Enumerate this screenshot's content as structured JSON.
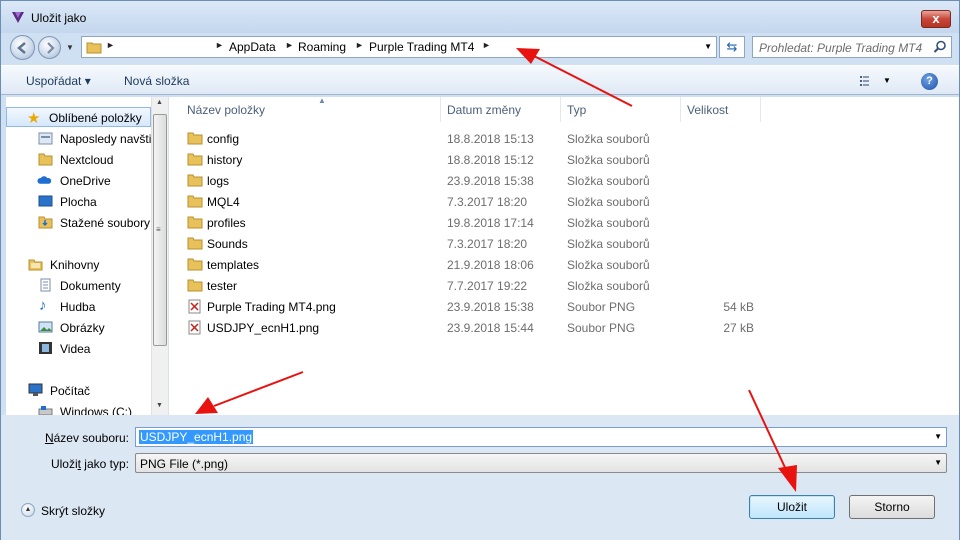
{
  "window": {
    "title": "Uložit jako",
    "close_label": "x"
  },
  "address": {
    "crumbs": [
      "AppData",
      "Roaming",
      "Purple Trading MT4"
    ],
    "search_placeholder": "Prohledat: Purple Trading MT4"
  },
  "toolbar": {
    "organize_label": "Uspořádat ▾",
    "new_folder_label": "Nová složka",
    "help_label": "?"
  },
  "navigation": {
    "favorites_header": "Oblíbené položky",
    "favorites": [
      "Naposledy navšti",
      "Nextcloud",
      "OneDrive",
      "Plocha",
      "Stažené soubory"
    ],
    "libraries_header": "Knihovny",
    "libraries": [
      "Dokumenty",
      "Hudba",
      "Obrázky",
      "Videa"
    ],
    "computer_header": "Počítač",
    "computer": [
      "Windows (C:)"
    ]
  },
  "columns": {
    "name": "Název položky",
    "date": "Datum změny",
    "type": "Typ",
    "size": "Velikost"
  },
  "files": [
    {
      "name": "config",
      "date": "18.8.2018 15:13",
      "type": "Složka souborů",
      "size": "",
      "kind": "folder"
    },
    {
      "name": "history",
      "date": "18.8.2018 15:12",
      "type": "Složka souborů",
      "size": "",
      "kind": "folder"
    },
    {
      "name": "logs",
      "date": "23.9.2018 15:38",
      "type": "Složka souborů",
      "size": "",
      "kind": "folder"
    },
    {
      "name": "MQL4",
      "date": "7.3.2017 18:20",
      "type": "Složka souborů",
      "size": "",
      "kind": "folder"
    },
    {
      "name": "profiles",
      "date": "19.8.2018 17:14",
      "type": "Složka souborů",
      "size": "",
      "kind": "folder"
    },
    {
      "name": "Sounds",
      "date": "7.3.2017 18:20",
      "type": "Složka souborů",
      "size": "",
      "kind": "folder"
    },
    {
      "name": "templates",
      "date": "21.9.2018 18:06",
      "type": "Složka souborů",
      "size": "",
      "kind": "folder"
    },
    {
      "name": "tester",
      "date": "7.7.2017 19:22",
      "type": "Složka souborů",
      "size": "",
      "kind": "folder"
    },
    {
      "name": "Purple Trading MT4.png",
      "date": "23.9.2018 15:38",
      "type": "Soubor PNG",
      "size": "54 kB",
      "kind": "png"
    },
    {
      "name": "USDJPY_ecnH1.png",
      "date": "23.9.2018 15:44",
      "type": "Soubor PNG",
      "size": "27 kB",
      "kind": "png"
    }
  ],
  "form": {
    "filename_label": "Název souboru:",
    "filename_value": "USDJPY_ecnH1.png",
    "filetype_label": "Uložit jako typ:",
    "filetype_value": "PNG File (*.png)"
  },
  "footer": {
    "hide_folders_label": "Skrýt složky",
    "save_label": "Uložit",
    "cancel_label": "Storno"
  },
  "colors": {
    "annotation_arrow": "#e8120f",
    "selection": "#3399ff"
  }
}
